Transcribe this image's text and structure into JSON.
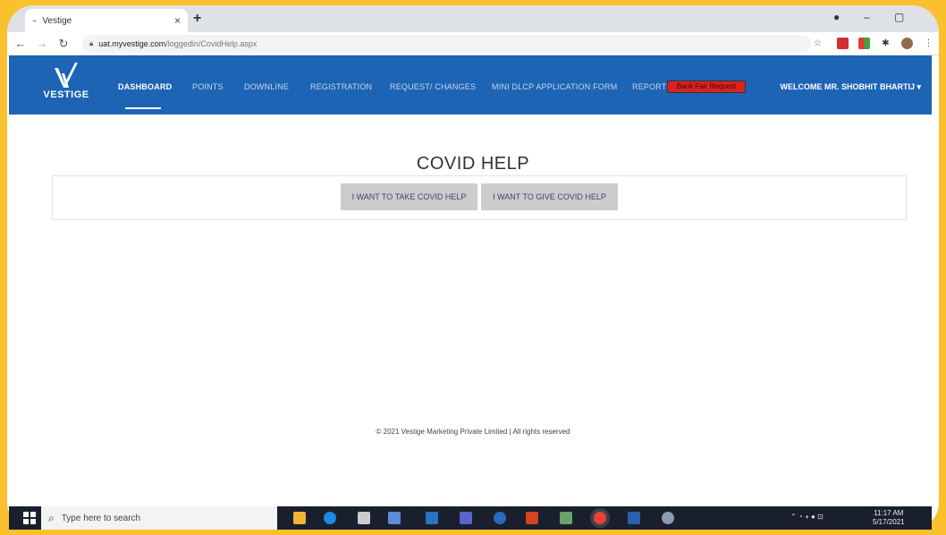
{
  "browser": {
    "tab_title": "Vestige",
    "tab_close": "×",
    "new_tab": "+",
    "url_host": "uat.myvestige.com",
    "url_path": "/loggedin/CovidHelp.aspx"
  },
  "nav": {
    "logo_text": "VESTIGE",
    "items": [
      {
        "label": "DASHBOARD",
        "active": true
      },
      {
        "label": "POINTS"
      },
      {
        "label": "DOWNLINE"
      },
      {
        "label": "REGISTRATION"
      },
      {
        "label": "REQUEST/ CHANGES"
      },
      {
        "label": "MINI DLCP APPLICATION FORM"
      },
      {
        "label": "REPORT"
      }
    ],
    "new_button": "Bank Fair Request",
    "welcome": "WELCOME MR. SHOBHIT BHARTIJ"
  },
  "page": {
    "heading": "COVID HELP",
    "take_button": "I WANT TO TAKE COVID HELP",
    "give_button": "I WANT TO GIVE COVID HELP",
    "footer": "© 2021 Vestige Marketing Private Limited | All rights reserved"
  },
  "taskbar": {
    "search_placeholder": "Type here to search",
    "time": "11:17 AM",
    "date": "5/17/2021"
  },
  "colors": {
    "frame": "#fbc02d",
    "nav_bg": "#1d64b5",
    "button_bg": "#cccccc",
    "new_button": "#d8231f"
  }
}
